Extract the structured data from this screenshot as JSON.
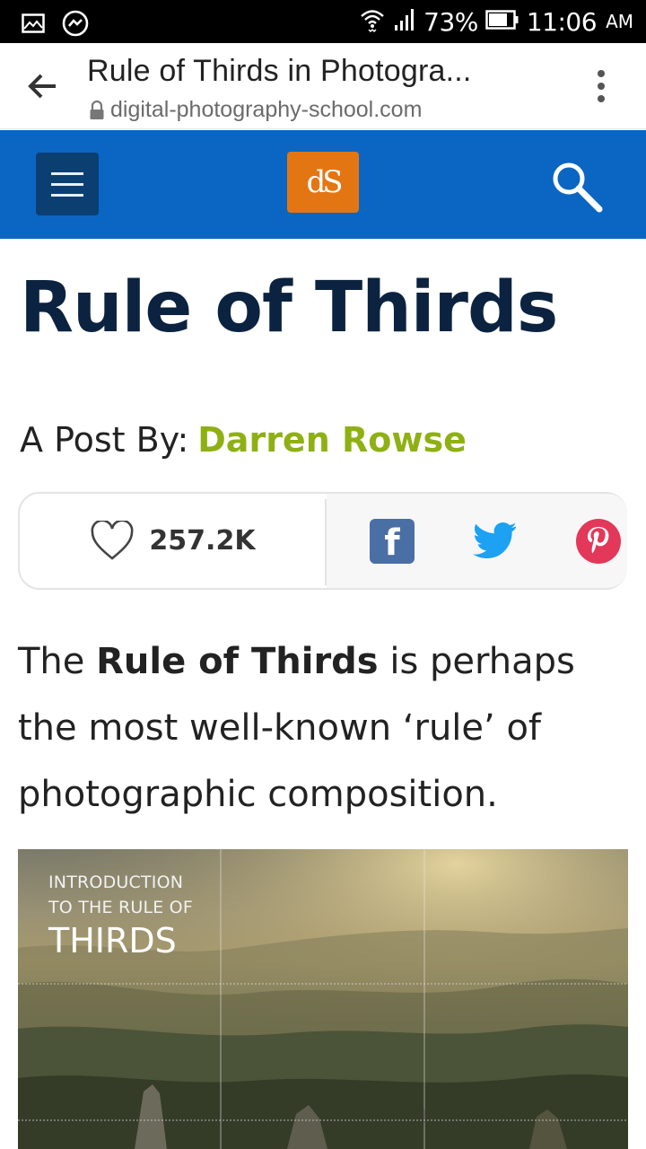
{
  "status_bar": {
    "signal_text": ".ıll",
    "battery": "73%",
    "time": "11:06",
    "ampm": "AM"
  },
  "browser": {
    "page_title": "Rule of Thirds in Photogra...",
    "url": "digital-photography-school.com"
  },
  "site": {
    "logo_text": "dS",
    "colors": {
      "header": "#0a66c2",
      "logo": "#e37613",
      "author": "#8fb014",
      "title": "#0b2340"
    }
  },
  "article": {
    "title": "Rule of Thirds",
    "byline_prefix": "A Post By:",
    "author": "Darren Rowse",
    "likes": "257.2K",
    "intro_bold": "Rule of Thirds",
    "intro_pre": "The",
    "intro_post": "is perhaps the most well-known ‘rule’ of photographic composition."
  },
  "hero": {
    "line1": "INTRODUCTION",
    "line2": "TO THE RULE OF",
    "line3": "THIRDS"
  },
  "share": {
    "facebook_glyph": "f"
  }
}
